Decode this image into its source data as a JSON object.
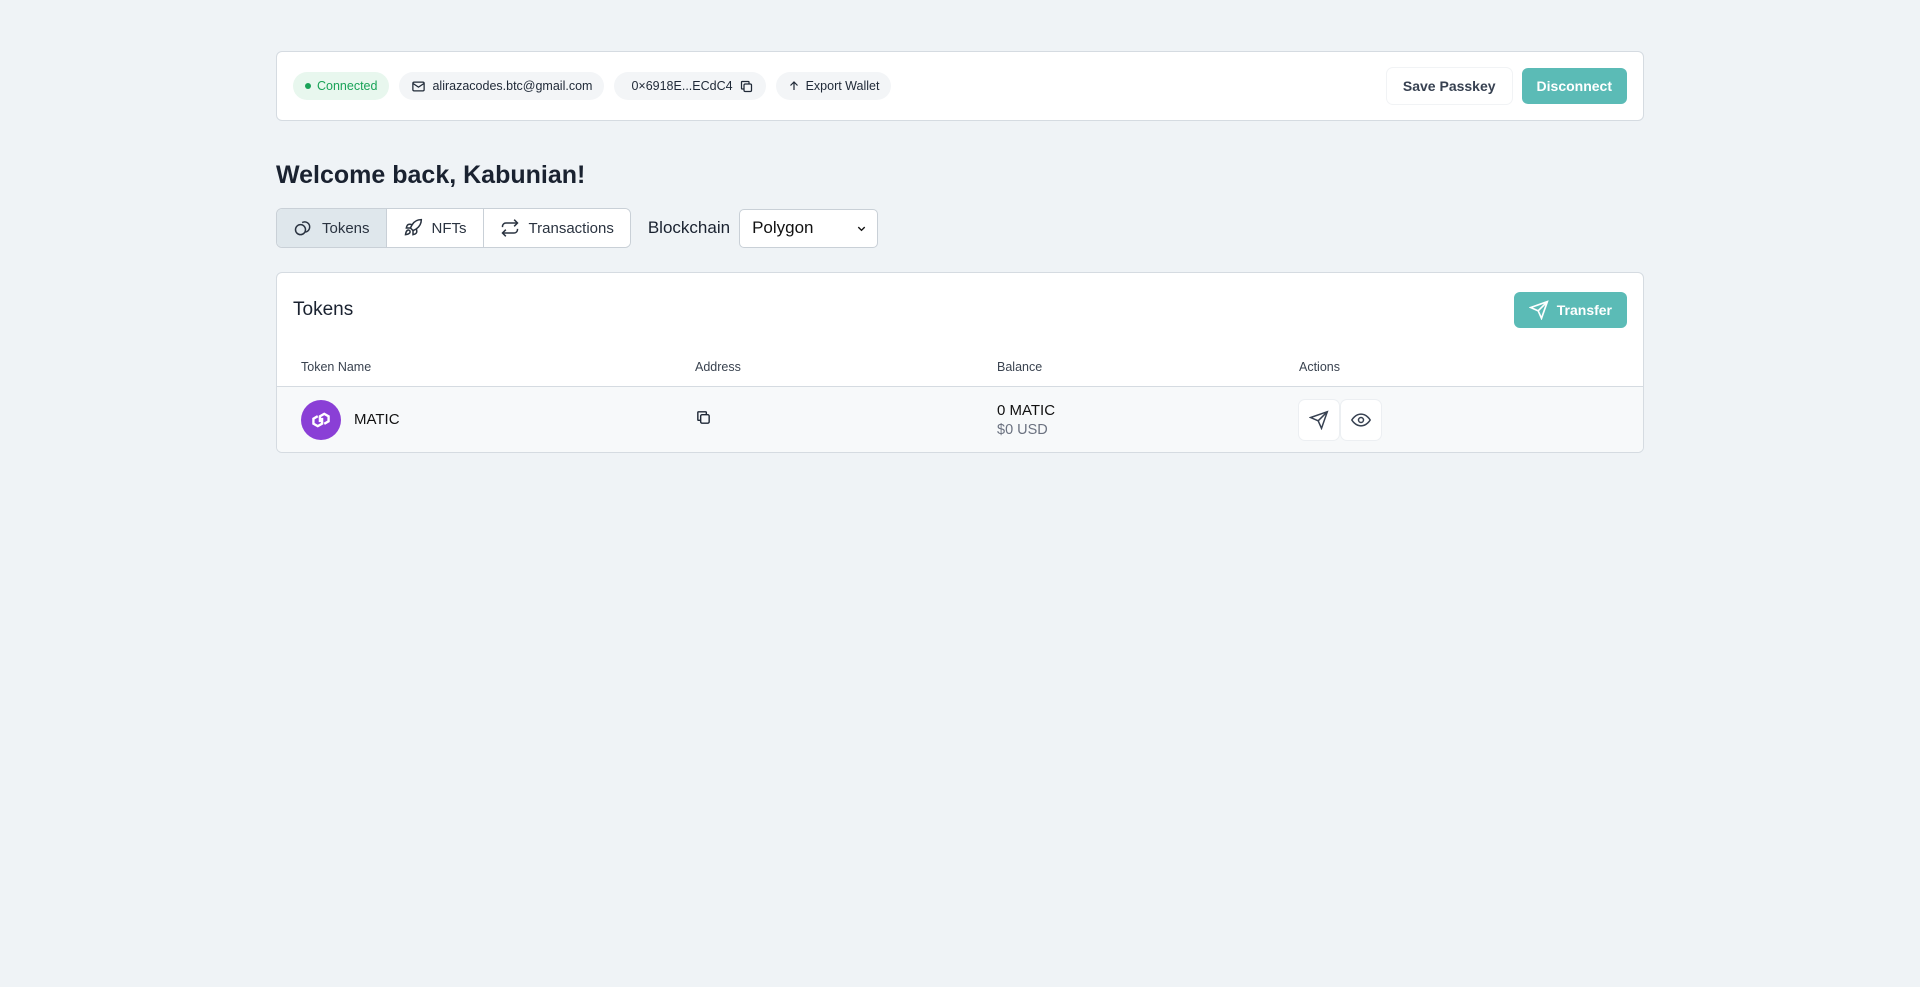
{
  "header": {
    "status": "Connected",
    "email": "alirazacodes.btc@gmail.com",
    "address": "0×6918E...ECdC4",
    "export_label": "Export Wallet",
    "save_passkey_label": "Save Passkey",
    "disconnect_label": "Disconnect"
  },
  "welcome": "Welcome back, Kabunian!",
  "tabs": [
    {
      "label": "Tokens",
      "icon": "coins-icon",
      "active": true
    },
    {
      "label": "NFTs",
      "icon": "rocket-icon",
      "active": false
    },
    {
      "label": "Transactions",
      "icon": "arrows-repeat-icon",
      "active": false
    }
  ],
  "blockchain": {
    "label": "Blockchain",
    "selected": "Polygon"
  },
  "tokens": {
    "title": "Tokens",
    "transfer_label": "Transfer",
    "columns": [
      "Token Name",
      "Address",
      "Balance",
      "Actions"
    ],
    "rows": [
      {
        "name": "MATIC",
        "balance": "0 MATIC",
        "usd": "$0 USD"
      }
    ]
  },
  "colors": {
    "accent": "#5bbbb6",
    "connected": "#1aa358",
    "matic": "#8a3fd6",
    "background": "#eff3f6"
  }
}
